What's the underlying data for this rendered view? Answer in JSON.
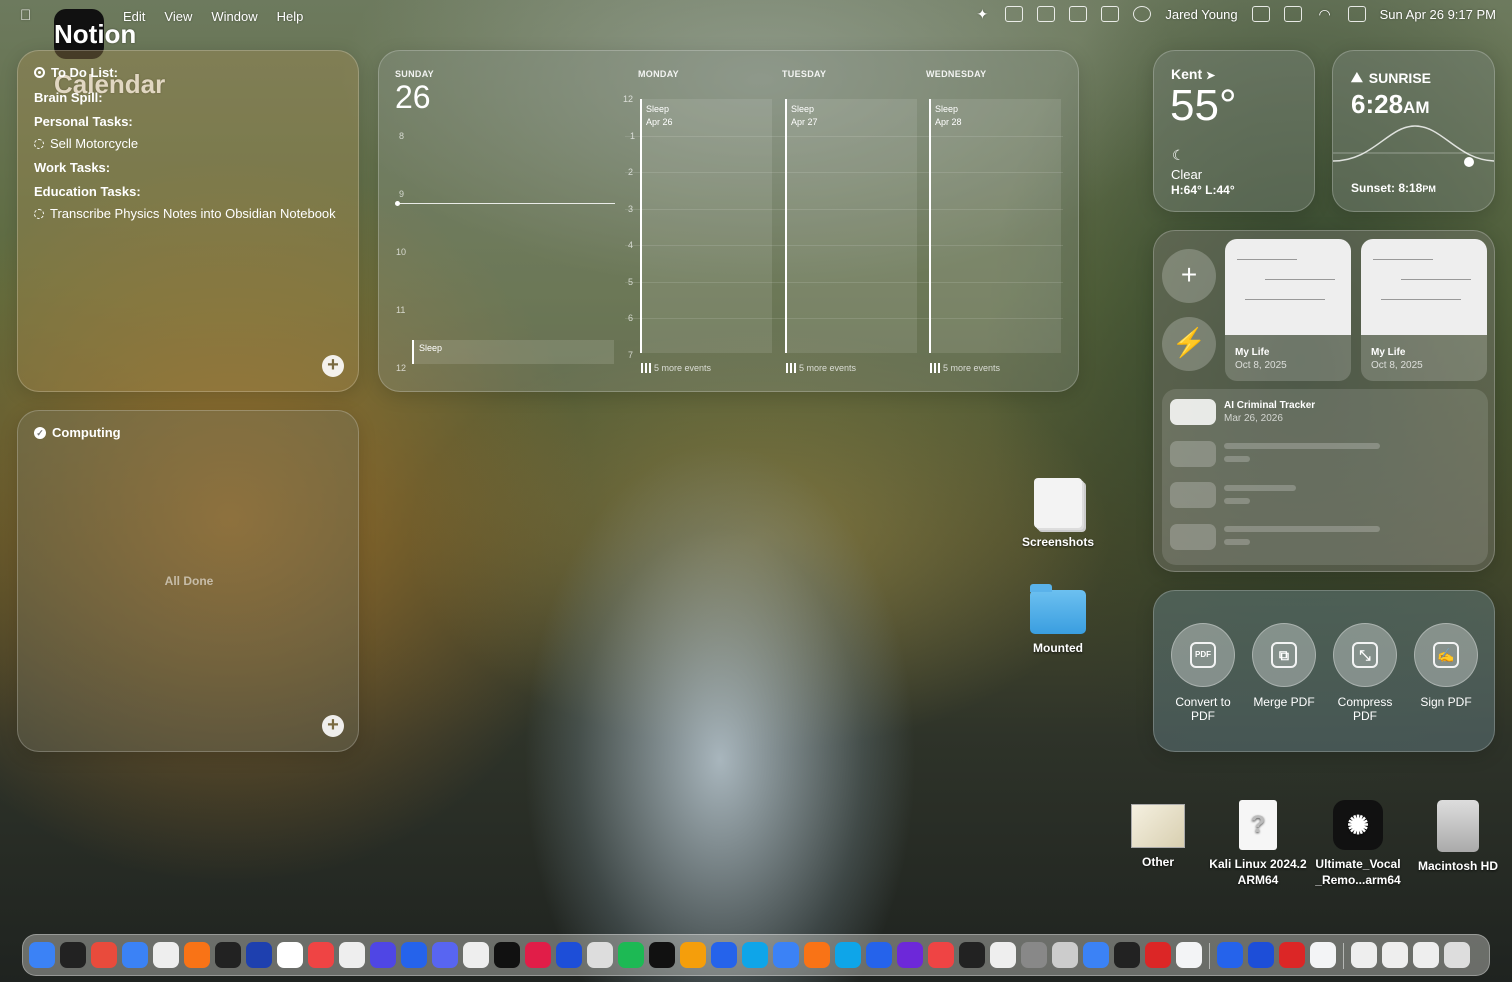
{
  "menubar": {
    "app_name": "Notion Calendar",
    "menus": [
      "Edit",
      "View",
      "Window",
      "Help"
    ],
    "user": "Jared Young",
    "datetime": "Sun Apr 26  9:17 PM"
  },
  "todo": {
    "title": "To Do List:",
    "brain_spill": "Brain Spill:",
    "personal": "Personal Tasks:",
    "personal_item": "Sell Motorcycle",
    "work": "Work Tasks:",
    "education": "Education Tasks:",
    "education_item": "Transcribe Physics Notes into Obsidian Notebook"
  },
  "computing": {
    "title": "Computing",
    "empty": "All Done"
  },
  "calendar": {
    "days": [
      "SUNDAY",
      "MONDAY",
      "TUESDAY",
      "WEDNESDAY"
    ],
    "today_num": "26",
    "sunday_hours": [
      "8",
      "9",
      "10",
      "11",
      "12"
    ],
    "week_hours": [
      "12",
      "1",
      "2",
      "3",
      "4",
      "5",
      "6",
      "7"
    ],
    "sunday_event": "Sleep",
    "events": [
      {
        "title": "Sleep",
        "date": "Apr 26"
      },
      {
        "title": "Sleep",
        "date": "Apr 27"
      },
      {
        "title": "Sleep",
        "date": "Apr 28"
      }
    ],
    "more": "5 more events"
  },
  "weather": {
    "city": "Kent",
    "temp": "55°",
    "condition": "Clear",
    "hilo": "H:64° L:44°"
  },
  "sun": {
    "label": "SUNRISE",
    "time": "6:28",
    "ampm": "AM",
    "sunset": "Sunset: 8:18",
    "sunset_ampm": "PM"
  },
  "notes": {
    "cards": [
      {
        "title": "My Life",
        "date": "Oct 8, 2025"
      },
      {
        "title": "My Life",
        "date": "Oct 8, 2025"
      }
    ],
    "list_title": "AI Criminal Tracker",
    "list_date": "Mar 26, 2026"
  },
  "pdf_tools": [
    {
      "label": "Convert to PDF",
      "glyph": "PDF"
    },
    {
      "label": "Merge PDF",
      "glyph": "⧉"
    },
    {
      "label": "Compress PDF",
      "glyph": "⤡"
    },
    {
      "label": "Sign PDF",
      "glyph": "✍"
    }
  ],
  "desktop": {
    "screenshots": "Screenshots",
    "mounted": "Mounted",
    "other": "Other",
    "kali": "Kali Linux 2024.2 ARM64",
    "uvr": "Ultimate_Vocal _Remo...arm64",
    "hd": "Macintosh HD"
  },
  "colors": {
    "accent": "#3a9ee0"
  }
}
